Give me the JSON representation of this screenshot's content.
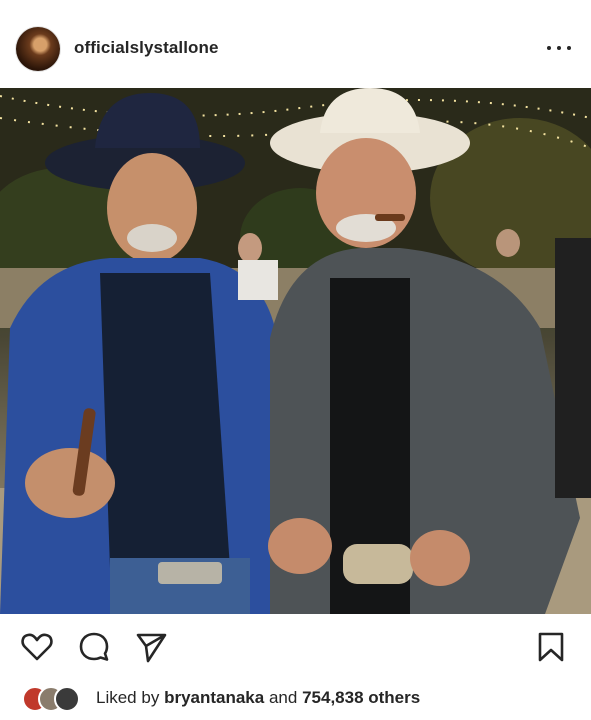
{
  "post": {
    "username": "officialslystallone",
    "photo_alt": "",
    "liked_prefix": "Liked by",
    "liked_user": "bryantanaka",
    "liked_and": "and",
    "liked_count": "754,838 others"
  },
  "icons": {
    "more": "more-horizontal-icon",
    "like": "heart-outline-icon",
    "comment": "comment-bubble-icon",
    "share": "paper-plane-icon",
    "save": "bookmark-outline-icon"
  },
  "colors": {
    "text": "#262626",
    "liker1": "#c0392b",
    "liker2": "#7a6a5a",
    "liker3": "#3a3a3a"
  }
}
